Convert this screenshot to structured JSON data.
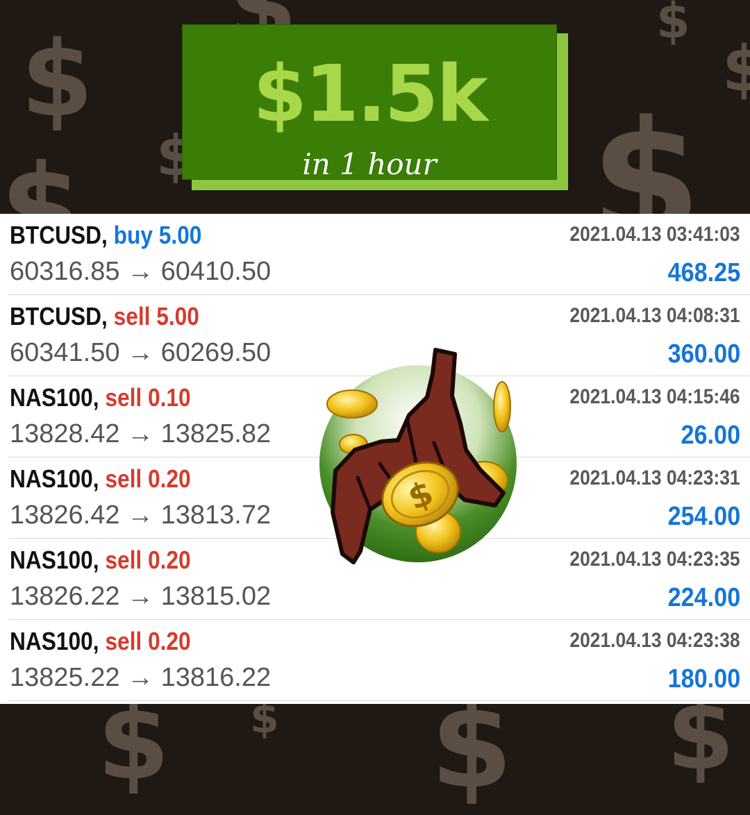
{
  "banner": {
    "amount": "$1.5k",
    "subtitle": "in 1 hour"
  },
  "colors": {
    "buy": "#1476d8",
    "sell": "#d63b2c",
    "profit": "#1476d8",
    "banner_green": "#3a7d07",
    "accent_green": "#8cc63f"
  },
  "trades": [
    {
      "symbol": "BTCUSD,",
      "side": "buy",
      "volume": "buy 5.00",
      "prices": "60316.85 → 60410.50",
      "time": "2021.04.13 03:41:03",
      "profit": "468.25"
    },
    {
      "symbol": "BTCUSD,",
      "side": "sell",
      "volume": "sell 5.00",
      "prices": "60341.50 → 60269.50",
      "time": "2021.04.13 04:08:31",
      "profit": "360.00"
    },
    {
      "symbol": "NAS100,",
      "side": "sell",
      "volume": "sell 0.10",
      "prices": "13828.42 → 13825.82",
      "time": "2021.04.13 04:15:46",
      "profit": "26.00"
    },
    {
      "symbol": "NAS100,",
      "side": "sell",
      "volume": "sell 0.20",
      "prices": "13826.42 → 13813.72",
      "time": "2021.04.13 04:23:31",
      "profit": "254.00"
    },
    {
      "symbol": "NAS100,",
      "side": "sell",
      "volume": "sell 0.20",
      "prices": "13826.22 → 13815.02",
      "time": "2021.04.13 04:23:35",
      "profit": "224.00"
    },
    {
      "symbol": "NAS100,",
      "side": "sell",
      "volume": "sell 0.20",
      "prices": "13825.22 → 13816.22",
      "time": "2021.04.13 04:23:38",
      "profit": "180.00"
    }
  ],
  "illustration": {
    "icon": "hand-grabbing-coins-icon"
  }
}
